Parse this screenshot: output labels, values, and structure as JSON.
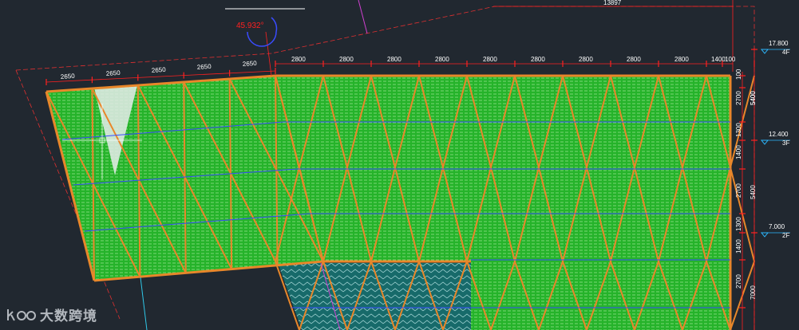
{
  "drawing": {
    "total_dimension": "13897",
    "angle_label": "45.932°",
    "dims_slanted": [
      "2650",
      "2650",
      "2650",
      "2650",
      "2650"
    ],
    "dims_top": [
      "2800",
      "2800",
      "2800",
      "2800",
      "2800",
      "2800",
      "2800",
      "2800",
      "2800",
      "1400",
      "100"
    ],
    "dims_right": [
      "100",
      "5400",
      "2700",
      "1300",
      "1400",
      "2700",
      "1300",
      "1400",
      "2700"
    ],
    "dims_outer_right": [
      "5400",
      "5400",
      "7000"
    ],
    "levels": [
      {
        "elevation": "17.800",
        "floor": "4F"
      },
      {
        "elevation": "12.400",
        "floor": "3F"
      },
      {
        "elevation": "7.000",
        "floor": "2F"
      }
    ],
    "colors": {
      "background": "#212830",
      "panel_green": "#25b32a",
      "frame_orange": "#e8872a",
      "dim_red": "#ff2020",
      "floor_blue": "#3a4cff",
      "glass_teal": "#176a6a"
    }
  },
  "watermark": {
    "text": "大数跨境"
  }
}
